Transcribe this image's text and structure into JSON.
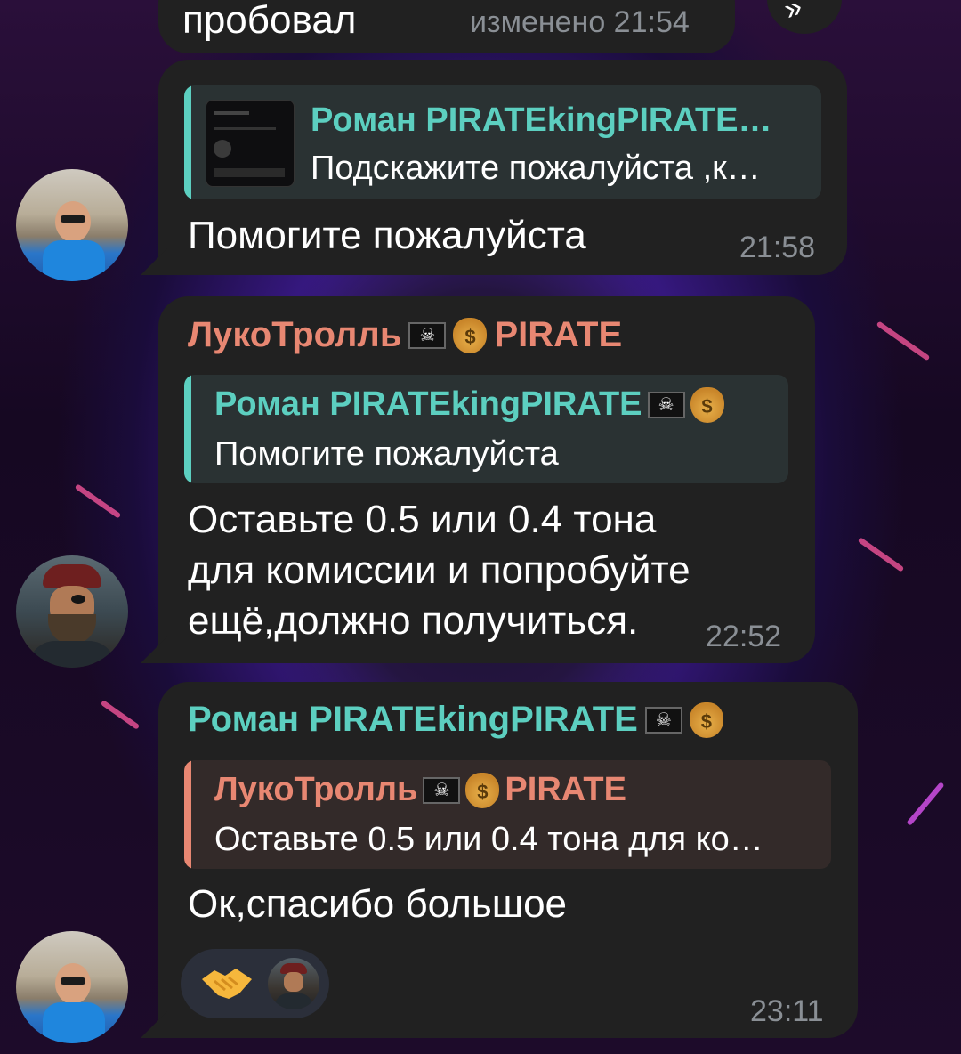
{
  "messages": [
    {
      "text": "пробовал",
      "time": "изменено 21:54"
    },
    {
      "reply": {
        "name": "Роман PIRATEkingPIRATE…",
        "text": "Подскажите пожалуйста ,к…"
      },
      "text": "Помогите пожалуйста",
      "time": "21:58",
      "avatar": "user-photo-avatar"
    },
    {
      "sender": "ЛукоТролль",
      "sender_suffix": "PIRATE",
      "reply": {
        "name": "Роман PIRATEkingPIRATE",
        "text": "Помогите пожалуйста"
      },
      "lines": [
        "Оставьте 0.5 или 0.4 тона",
        "для комиссии и попробуйте",
        "ещё,должно получиться."
      ],
      "time": "22:52",
      "avatar": "pirate-avatar"
    },
    {
      "sender": "Роман PIRATEkingPIRATE",
      "reply": {
        "name": "ЛукоТролль",
        "name_suffix": "PIRATE",
        "text": "Оставьте 0.5 или 0.4 тона для ко…"
      },
      "text": "Ок,спасибо большое",
      "reaction": "handshake",
      "time": "23:11",
      "avatar": "user-photo-avatar"
    }
  ],
  "icons": {
    "flag": "pirate-flag-icon",
    "moneybag": "money-bag-icon",
    "forward": "forward-icon",
    "handshake": "handshake-icon"
  },
  "colors": {
    "bubble": "#212121",
    "teal_name": "#5ccfc0",
    "salmon_name": "#e88772",
    "time": "#8a8f95"
  }
}
